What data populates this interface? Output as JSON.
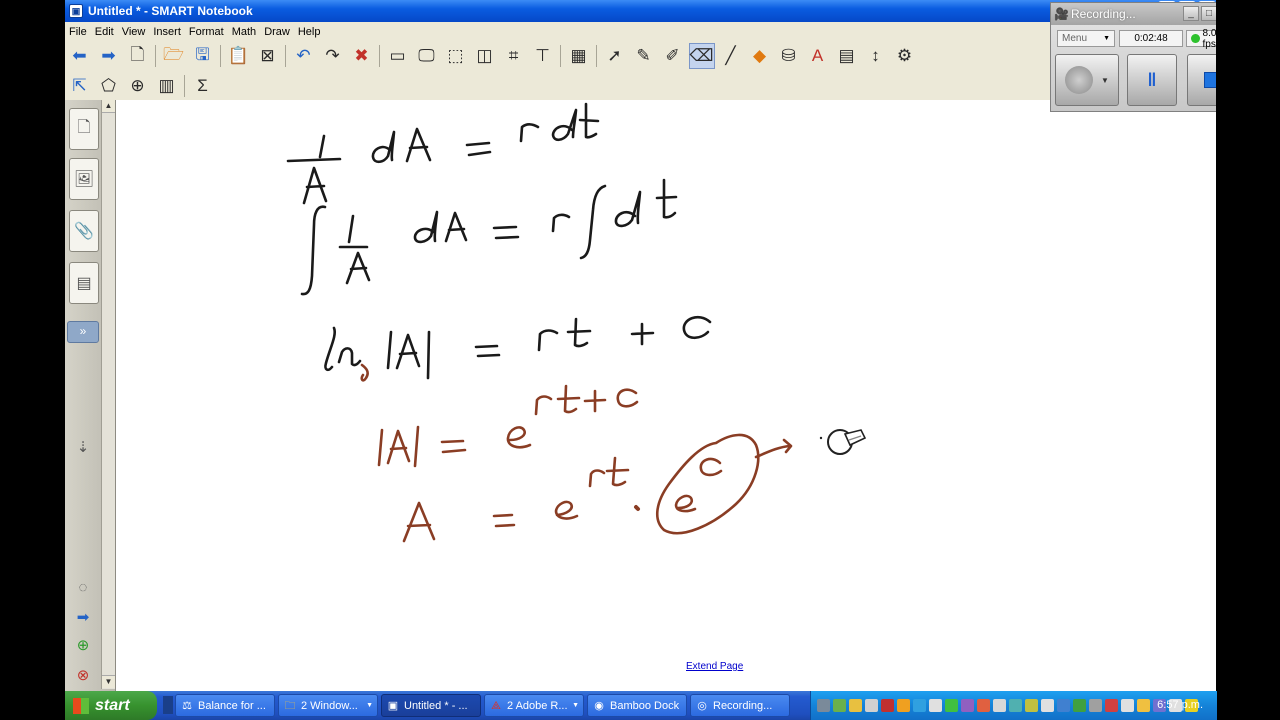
{
  "window": {
    "title": "Untitled * - SMART Notebook"
  },
  "menu": [
    "File",
    "Edit",
    "View",
    "Insert",
    "Format",
    "Math",
    "Draw",
    "Help"
  ],
  "toolbar_row1": [
    "back-icon",
    "forward-icon",
    "new-page-icon",
    "open-icon",
    "save-icon",
    "paste-icon",
    "delete-page-icon",
    "undo-icon",
    "redo-icon",
    "delete-icon",
    "screen-shade-icon",
    "full-screen-icon",
    "transparent-bg-icon",
    "dual-page-icon",
    "capture-icon",
    "document-camera-icon",
    "table-icon",
    "select-icon",
    "pen-icon",
    "creative-pen-icon",
    "eraser-icon",
    "line-icon",
    "shapes-icon",
    "fill-icon",
    "text-icon",
    "properties-icon",
    "move-toolbar-icon",
    "customize-icon"
  ],
  "toolbar_row2": [
    "magic-pen-icon",
    "shape-recognition-icon",
    "measurement-icon",
    "table-tool-icon",
    "math-sigma-icon"
  ],
  "canvas": {
    "extend_page": "Extend Page",
    "ink_color_black": "#1a1a1a",
    "ink_color_brown": "#8a3d24"
  },
  "recorder": {
    "title": "Recording...",
    "mode_label": "Menu",
    "elapsed": "0:02:48",
    "fps": "8.0 fps",
    "status_color": "#2ec22e"
  },
  "taskbar": {
    "start_label": "start",
    "tasks": [
      {
        "label": "Balance for ...",
        "icon": "balance-icon"
      },
      {
        "label": "2 Window...",
        "icon": "folder-icon"
      },
      {
        "label": "Untitled * - ...",
        "icon": "smart-notebook-icon"
      },
      {
        "label": "2 Adobe R...",
        "icon": "adobe-reader-icon"
      },
      {
        "label": "Bamboo Dock",
        "icon": "bamboo-icon"
      },
      {
        "label": "Recording...",
        "icon": "recorder-icon"
      }
    ],
    "clock": "6:57 p.m."
  }
}
